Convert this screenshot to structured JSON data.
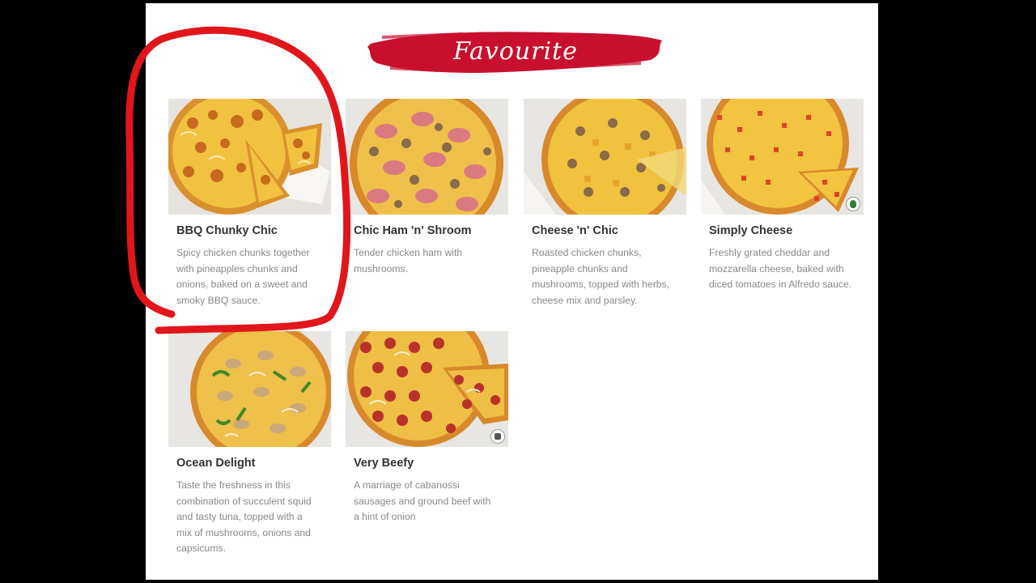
{
  "section": {
    "title": "Favourite",
    "banner_color": "#c8102e"
  },
  "menu": {
    "items": [
      {
        "name": "BBQ Chunky Chic",
        "description": "Spicy chicken chunks together with pineapples chunks and onions, baked on a sweet and smoky BBQ sauce.",
        "badge": ""
      },
      {
        "name": "Chic Ham 'n' Shroom",
        "description": "Tender chicken ham with mushrooms.",
        "badge": ""
      },
      {
        "name": "Cheese 'n' Chic",
        "description": "Roasted chicken chunks, pineapple chunks and mushrooms, topped with herbs, cheese mix and parsley.",
        "badge": ""
      },
      {
        "name": "Simply Cheese",
        "description": "Freshly grated cheddar and mozzarella cheese, baked with diced tomatoes in Alfredo sauce.",
        "badge": "vegetarian-icon"
      },
      {
        "name": "Ocean Delight",
        "description": "Taste the freshness in this combination of succulent squid and tasty tuna, topped with a mix of mushrooms, onions and capsicums.",
        "badge": ""
      },
      {
        "name": "Very Beefy",
        "description": "A marriage of cabanossi sausages and ground beef with a hint of onion",
        "badge": "beef-icon"
      }
    ]
  },
  "annotation": {
    "color": "#e0161b",
    "target": "BBQ Chunky Chic"
  }
}
